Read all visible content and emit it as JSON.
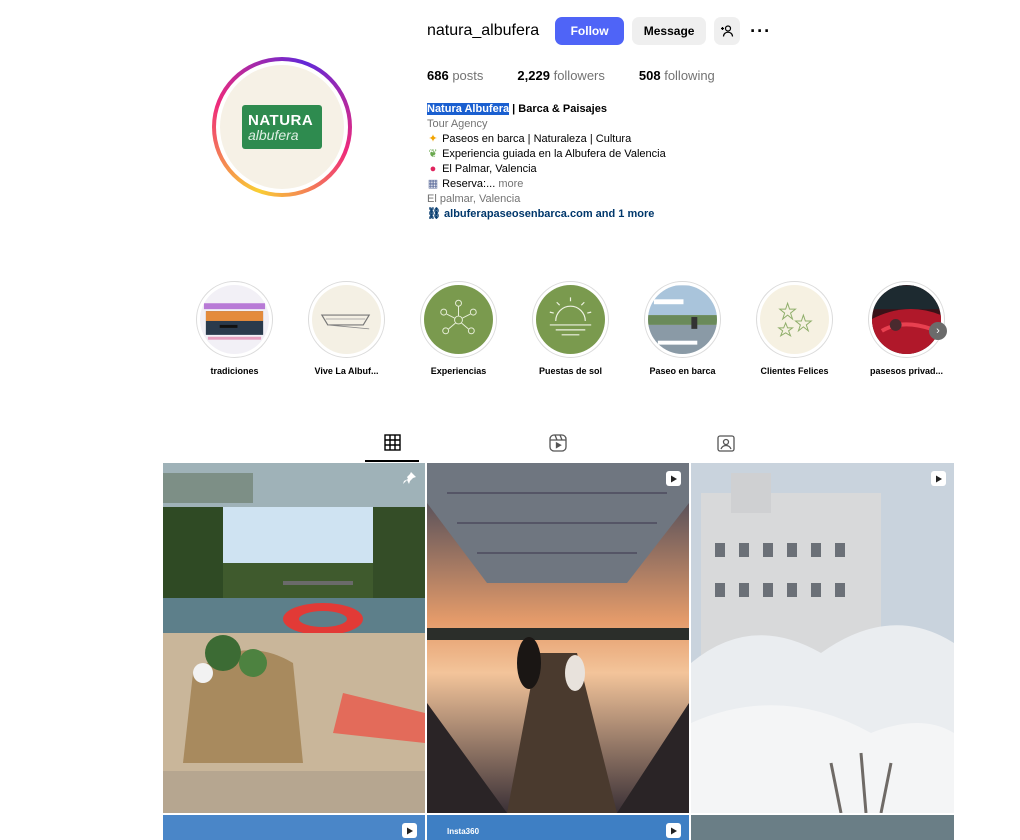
{
  "profile": {
    "username": "natura_albufera",
    "follow_label": "Follow",
    "message_label": "Message",
    "logo_line1": "NATURA",
    "logo_line2": "albufera",
    "stats": {
      "posts_count": "686",
      "posts_label": "posts",
      "followers_count": "2,229",
      "followers_label": "followers",
      "following_count": "508",
      "following_label": "following"
    },
    "bio": {
      "name_highlight": "Natura Albufera",
      "name_rest": " | Barca & Paisajes",
      "category": "Tour Agency",
      "line1": "Paseos en barca | Naturaleza | Cultura",
      "line2": "Experiencia guiada en la Albufera de Valencia",
      "line3": "El Palmar, Valencia",
      "line4": "Reserva:...",
      "more": "more",
      "location": "El palmar, Valencia",
      "link": "albuferapaseosenbarca.com and 1 more"
    }
  },
  "highlights": [
    {
      "label": "tradiciones"
    },
    {
      "label": "Vive La Albuf..."
    },
    {
      "label": "Experiencias"
    },
    {
      "label": "Puestas de sol"
    },
    {
      "label": "Paseo en barca"
    },
    {
      "label": "Clientes Felices"
    },
    {
      "label": "pasesos privad..."
    }
  ],
  "grid": {
    "watermark": "Insta360"
  },
  "colors": {
    "follow_button": "#4f64f7",
    "link": "#00376b",
    "secondary_text": "#737373",
    "highlight_green": "#7a9a4e"
  }
}
